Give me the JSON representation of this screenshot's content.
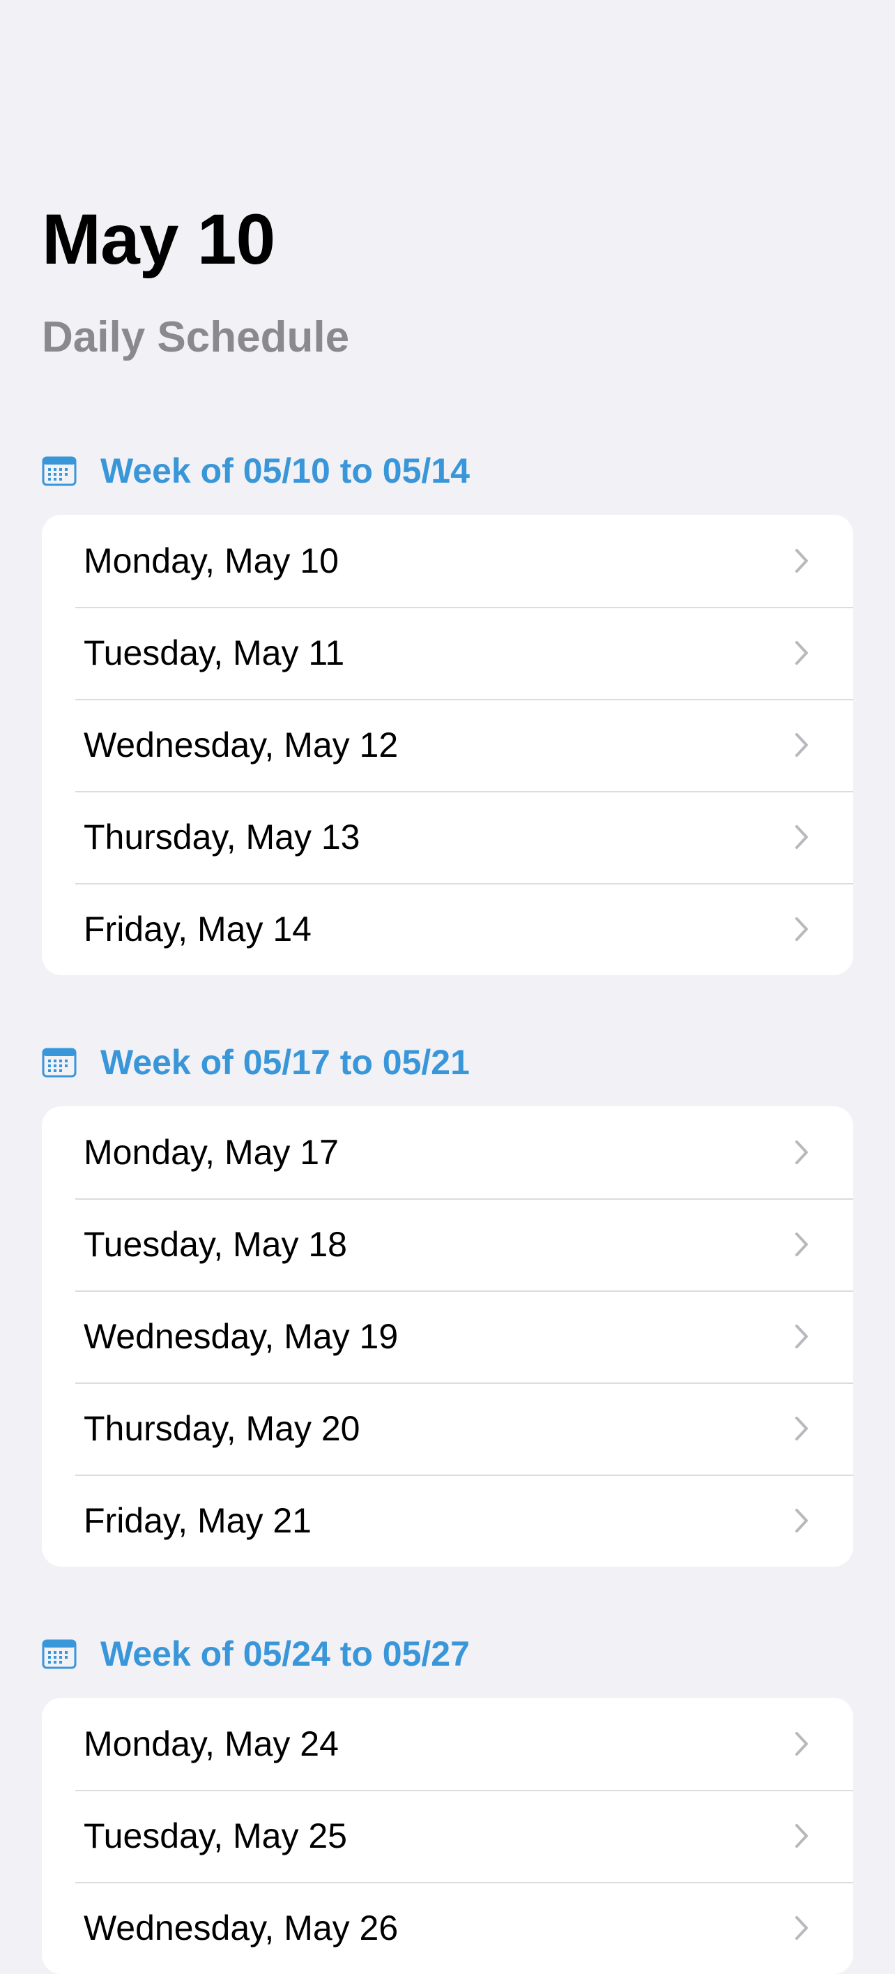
{
  "header": {
    "title": "May 10",
    "subtitle": "Daily Schedule"
  },
  "colors": {
    "background": "#f1f1f6",
    "accent": "#3996d8",
    "subtitle": "#8a8a8e",
    "chevron": "#b8b8bd",
    "separator": "#dcdce0"
  },
  "icons": {
    "section": "calendar-icon",
    "row": "chevron-right-icon"
  },
  "weeks": [
    {
      "title": "Week of 05/10 to 05/14",
      "days": [
        "Monday, May 10",
        "Tuesday, May 11",
        "Wednesday, May 12",
        "Thursday, May 13",
        "Friday, May 14"
      ]
    },
    {
      "title": "Week of 05/17 to 05/21",
      "days": [
        "Monday, May 17",
        "Tuesday, May 18",
        "Wednesday, May 19",
        "Thursday, May 20",
        "Friday, May 21"
      ]
    },
    {
      "title": "Week of 05/24 to 05/27",
      "days": [
        "Monday, May 24",
        "Tuesday, May 25",
        "Wednesday, May 26"
      ]
    }
  ]
}
